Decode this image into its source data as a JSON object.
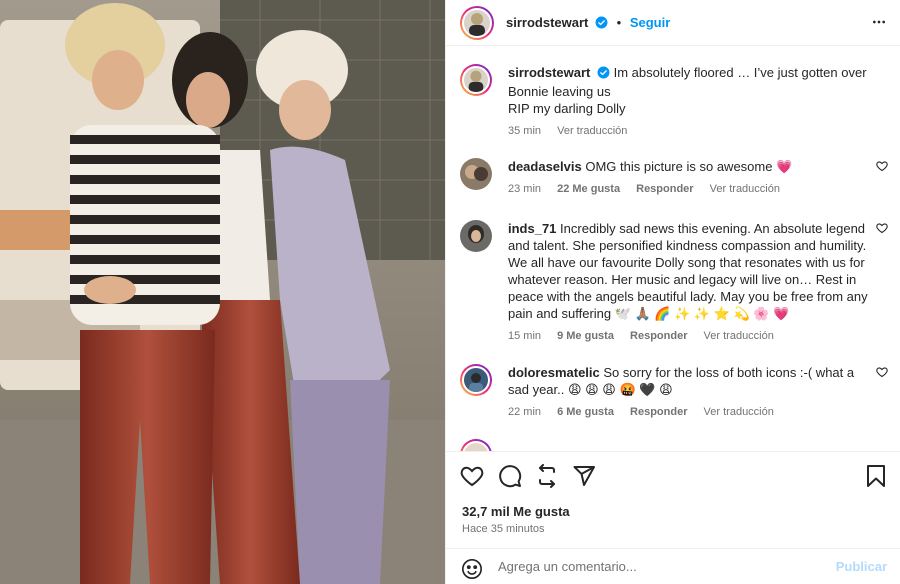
{
  "post": {
    "username": "sirrodstewart",
    "follow_label": "Seguir",
    "separator": "•",
    "caption_user": "sirrodstewart",
    "caption_line1": "Im absolutely floored … I’ve just gotten over",
    "caption_line2": "Bonnie leaving us",
    "caption_line3": "RIP my darling Dolly",
    "caption_time": "35 min",
    "caption_translate": "Ver traducción"
  },
  "comments": [
    {
      "user": "deadaselvis",
      "text": "OMG this picture is so awesome 💗",
      "time": "23 min",
      "likes": "22 Me gusta",
      "reply": "Responder",
      "translate": "Ver traducción"
    },
    {
      "user": "inds_71",
      "text": "Incredibly sad news this evening. An absolute legend and talent. She personified kindness compassion and humility. We all have our favourite Dolly song that resonates with us for whatever reason. Her music and legacy will live on… Rest in peace with the angels beautiful lady. May you be free from any pain and suffering 🕊️ 🙏🏽 🌈 ✨ ✨ ⭐ 💫 🌸 💗",
      "time": "15 min",
      "likes": "9 Me gusta",
      "reply": "Responder",
      "translate": "Ver traducción"
    },
    {
      "user": "doloresmatelic",
      "text": "So sorry for the loss of both icons :-( what a sad year.. 😩 😩 😩 🤬 🖤 😩",
      "time": "22 min",
      "likes": "6 Me gusta",
      "reply": "Responder",
      "translate": "Ver traducción"
    }
  ],
  "actions": {
    "likes": "32,7 mil Me gusta",
    "time_ago": "Hace 35 minutos"
  },
  "add_comment": {
    "placeholder": "Agrega un comentario...",
    "publish": "Publicar"
  },
  "icons": [
    "verified-icon",
    "more-icon",
    "heart-icon",
    "comment-icon",
    "repost-icon",
    "share-icon",
    "bookmark-icon",
    "emoji-icon"
  ],
  "colors": {
    "accent": "#0095f6",
    "verified": "#0095f6",
    "publish_disabled": "#b3dbff",
    "muted": "#737373"
  }
}
